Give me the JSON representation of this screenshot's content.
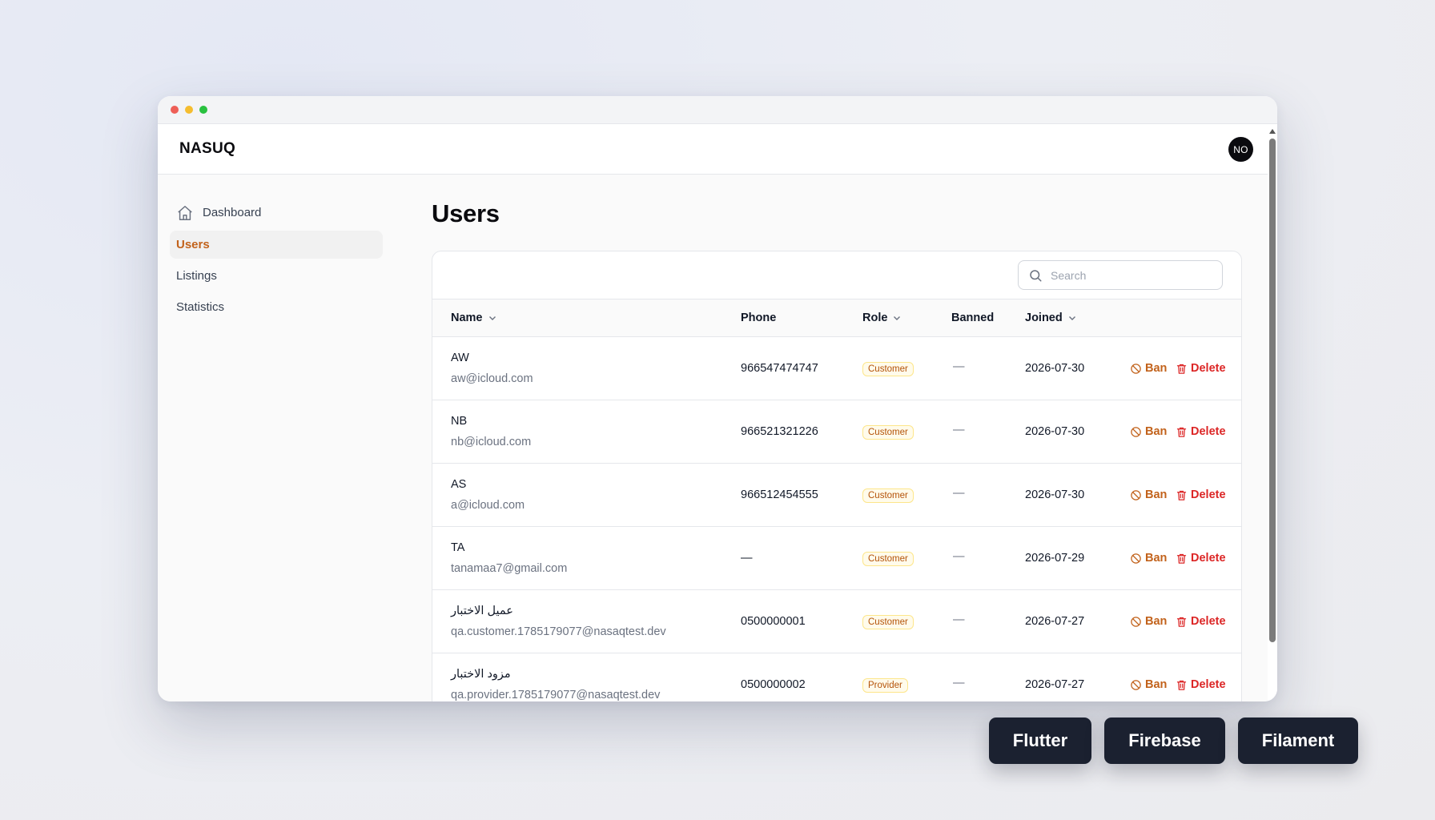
{
  "app": {
    "brand": "NASUQ",
    "avatar_initials": "NO"
  },
  "sidebar": {
    "items": [
      {
        "label": "Dashboard",
        "icon": "home-icon",
        "active": false
      },
      {
        "label": "Users",
        "active": true
      },
      {
        "label": "Listings",
        "active": false
      },
      {
        "label": "Statistics",
        "active": false
      }
    ]
  },
  "page": {
    "title": "Users"
  },
  "search": {
    "placeholder": "Search",
    "value": ""
  },
  "table": {
    "columns": {
      "name": "Name",
      "phone": "Phone",
      "role": "Role",
      "banned": "Banned",
      "joined": "Joined"
    },
    "actions": {
      "ban": "Ban",
      "delete": "Delete"
    },
    "rows": [
      {
        "name": "AW",
        "email": "aw@icloud.com",
        "phone": "966547474747",
        "role": "Customer",
        "banned": "—",
        "joined": "2026-07-30"
      },
      {
        "name": "NB",
        "email": "nb@icloud.com",
        "phone": "966521321226",
        "role": "Customer",
        "banned": "—",
        "joined": "2026-07-30"
      },
      {
        "name": "AS",
        "email": "a@icloud.com",
        "phone": "966512454555",
        "role": "Customer",
        "banned": "—",
        "joined": "2026-07-30"
      },
      {
        "name": "TA",
        "email": "tanamaa7@gmail.com",
        "phone": "—",
        "role": "Customer",
        "banned": "—",
        "joined": "2026-07-29"
      },
      {
        "name": "عميل الاختبار",
        "email": "qa.customer.1785179077@nasaqtest.dev",
        "phone": "0500000001",
        "role": "Customer",
        "banned": "—",
        "joined": "2026-07-27"
      },
      {
        "name": "مزود الاختبار",
        "email": "qa.provider.1785179077@nasaqtest.dev",
        "phone": "0500000002",
        "role": "Provider",
        "banned": "—",
        "joined": "2026-07-27"
      }
    ]
  },
  "tech_tags": [
    "Flutter",
    "Firebase",
    "Filament"
  ],
  "colors": {
    "accent": "#c2621b",
    "danger": "#dc2626",
    "tag_bg": "#1b2130"
  }
}
